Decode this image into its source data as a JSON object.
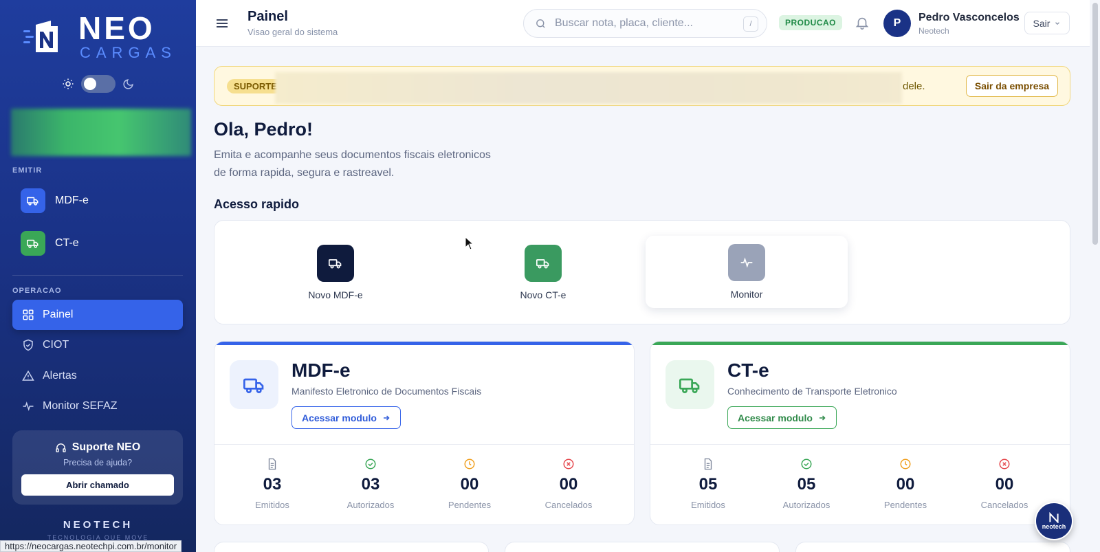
{
  "sidebar": {
    "logo": {
      "word1": "NEO",
      "word2": "CARGAS"
    },
    "sections": {
      "emit": "EMITIR",
      "operation": "OPERACAO"
    },
    "emit_items": [
      {
        "label": "MDF-e",
        "icon": "truck-icon",
        "color": "#3563e9"
      },
      {
        "label": "CT-e",
        "icon": "truck-icon",
        "color": "#3aa757"
      }
    ],
    "op_items": [
      {
        "label": "Painel",
        "icon": "grid-icon",
        "active": true
      },
      {
        "label": "CIOT",
        "icon": "shield-check-icon",
        "active": false
      },
      {
        "label": "Alertas",
        "icon": "warning-triangle-icon",
        "active": false
      },
      {
        "label": "Monitor SEFAZ",
        "icon": "activity-icon",
        "active": false
      }
    ],
    "support": {
      "title": "Suporte NEO",
      "subtitle": "Precisa de ajuda?",
      "button": "Abrir chamado"
    },
    "footer": {
      "brand": "NEOTECH",
      "tagline": "TECNOLOGIA QUE MOVE"
    }
  },
  "topbar": {
    "title": "Painel",
    "subtitle": "Visao geral do sistema",
    "search": {
      "placeholder": "Buscar nota, placa, cliente...",
      "shortcut": "/"
    },
    "environment": "PRODUCAO",
    "user": {
      "initial": "P",
      "name": "Pedro Vasconcelos",
      "company": "Neotech"
    },
    "logout": "Sair"
  },
  "notice": {
    "badge": "SUPORTE",
    "tail_text": "dele.",
    "button": "Sair da empresa"
  },
  "greeting": {
    "title": "Ola, Pedro!",
    "subtitle": "Emita e acompanhe seus documentos fiscais eletronicos de forma rapida, segura e rastreavel."
  },
  "quick_access": {
    "title": "Acesso rapido",
    "items": [
      {
        "label": "Novo MDF-e",
        "color": "#0f1b3d"
      },
      {
        "label": "Novo CT-e",
        "color": "#3a9a60"
      },
      {
        "label": "Monitor",
        "color": "#9aa3b8"
      }
    ]
  },
  "modules": [
    {
      "name": "MDF-e",
      "description": "Manifesto Eletronico de Documentos Fiscais",
      "button": "Acessar modulo",
      "accent": "#3563e9",
      "stats": [
        {
          "value": "03",
          "label": "Emitidos",
          "icon": "document-icon"
        },
        {
          "value": "03",
          "label": "Autorizados",
          "icon": "check-circle-icon"
        },
        {
          "value": "00",
          "label": "Pendentes",
          "icon": "clock-icon"
        },
        {
          "value": "00",
          "label": "Cancelados",
          "icon": "x-circle-icon"
        }
      ]
    },
    {
      "name": "CT-e",
      "description": "Conhecimento de Transporte Eletronico",
      "button": "Acessar modulo",
      "accent": "#3aa757",
      "stats": [
        {
          "value": "05",
          "label": "Emitidos",
          "icon": "document-icon"
        },
        {
          "value": "05",
          "label": "Autorizados",
          "icon": "check-circle-icon"
        },
        {
          "value": "00",
          "label": "Pendentes",
          "icon": "clock-icon"
        },
        {
          "value": "00",
          "label": "Cancelados",
          "icon": "x-circle-icon"
        }
      ]
    }
  ],
  "status_bar": {
    "url": "https://neocargas.neotechpi.com.br/monitor"
  },
  "fab": {
    "label": "neotech"
  }
}
